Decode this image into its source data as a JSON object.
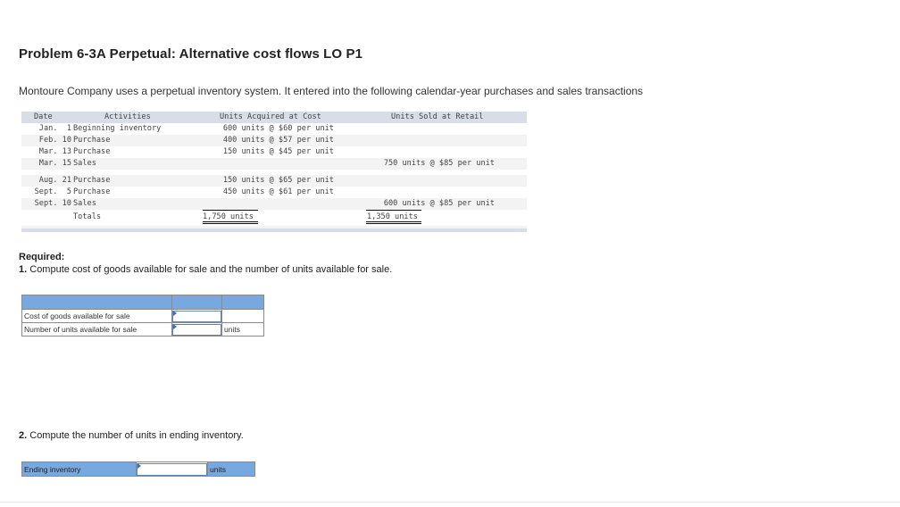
{
  "title": "Problem 6-3A Perpetual: Alternative cost flows LO P1",
  "intro": "Montoure Company uses a perpetual inventory system. It entered into the following calendar-year purchases and sales transactions",
  "transactions": {
    "headers": {
      "date": "Date",
      "activities": "Activities",
      "acquired": "Units Acquired at Cost",
      "sold": "Units Sold at Retail"
    },
    "rows": [
      {
        "date": "Jan.  1",
        "activity": "Beginning inventory",
        "acquired": "600 units @ $60 per unit",
        "sold": ""
      },
      {
        "date": "Feb. 10",
        "activity": "Purchase",
        "acquired": "400 units @ $57 per unit",
        "sold": ""
      },
      {
        "date": "Mar. 13",
        "activity": "Purchase",
        "acquired": "150 units @ $45 per unit",
        "sold": ""
      },
      {
        "date": "Mar. 15",
        "activity": "Sales",
        "acquired": "",
        "sold": "750 units @ $85 per unit"
      },
      {
        "date": "Aug. 21",
        "activity": "Purchase",
        "acquired": "150 units @ $65 per unit",
        "sold": ""
      },
      {
        "date": "Sept.  5",
        "activity": "Purchase",
        "acquired": "450 units @ $61 per unit",
        "sold": ""
      },
      {
        "date": "Sept. 10",
        "activity": "Sales",
        "acquired": "",
        "sold": "600 units @ $85 per unit"
      }
    ],
    "totals": {
      "label": "Totals",
      "acquired": "1,750 units",
      "sold": "1,350 units"
    }
  },
  "required": {
    "heading": "Required:",
    "q1_num": "1.",
    "q1_text": " Compute cost of goods available for sale and the number of units available for sale.",
    "q1_rows": [
      {
        "label": "Cost of goods available for sale",
        "value": "",
        "unit": ""
      },
      {
        "label": "Number of units available for sale",
        "value": "",
        "unit": "units"
      }
    ],
    "q2_num": "2.",
    "q2_text": " Compute the number of units in ending inventory.",
    "q2_row": {
      "label": "Ending inventory",
      "value": "",
      "unit": "units"
    }
  }
}
